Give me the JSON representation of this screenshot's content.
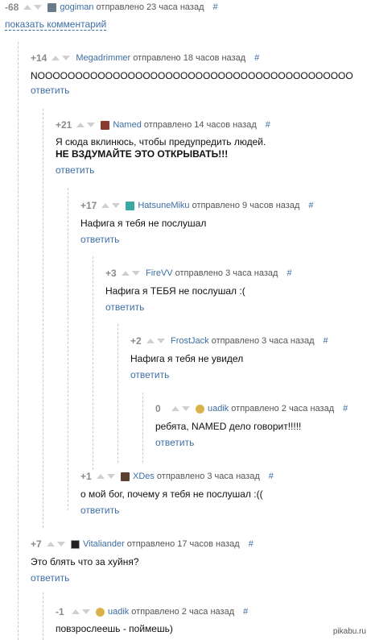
{
  "show_comments_label": "показать комментарий",
  "watermark": "pikabu.ru",
  "colors": {
    "link": "#3d6ea3",
    "rating": "#8a8a8a",
    "arrow": "#cfcfcf",
    "guide": "#c9c9c9"
  },
  "icons": {
    "upvote": "triangle-up",
    "downvote": "triangle-down"
  },
  "comments": [
    {
      "rating": "-68",
      "author": "gogiman",
      "sent": "отправлено 23 часа назад",
      "hash": "#",
      "body": "",
      "body_strong": "",
      "reply": "",
      "avatar_color": "#6b7b8a"
    },
    {
      "rating": "+14",
      "author": "Megadrimmer",
      "sent": "отправлено 18 часов назад",
      "hash": "#",
      "body": "NOOOOOOOOOOOOOOOOOOOOOOOOOOOOOOOOOOOOOOOOOO",
      "body_strong": "",
      "reply": "ответить",
      "avatar_color": ""
    },
    {
      "rating": "+21",
      "author": "Named",
      "sent": "отправлено 14 часов назад",
      "hash": "#",
      "body": "Я сюда вклинюсь, чтобы предупредить людей.",
      "body_strong": "НЕ ВЗДУМАЙТЕ ЭТО ОТКРЫВАТЬ!!!",
      "reply": "ответить",
      "avatar_color": "#8a3a2e"
    },
    {
      "rating": "+17",
      "author": "HatsuneMiku",
      "sent": "отправлено 9 часов назад",
      "hash": "#",
      "body": "Нафига я тебя не послушал",
      "body_strong": "",
      "reply": "ответить",
      "avatar_color": "#3aa7a0"
    },
    {
      "rating": "+3",
      "author": "FireVV",
      "sent": "отправлено 3 часа назад",
      "hash": "#",
      "body": "Нафига я ТЕБЯ не послушал :(",
      "body_strong": "",
      "reply": "ответить",
      "avatar_color": ""
    },
    {
      "rating": "+2",
      "author": "FrostJack",
      "sent": "отправлено 3 часа назад",
      "hash": "#",
      "body": "Нафига я тебя не увидел",
      "body_strong": "",
      "reply": "ответить",
      "avatar_color": ""
    },
    {
      "rating": "0",
      "author": "uadik",
      "sent": "отправлено 2 часа назад",
      "hash": "#",
      "body": "ребята, NAMED дело говорит!!!!!",
      "body_strong": "",
      "reply": "ответить",
      "avatar_color": "#d9b24a"
    },
    {
      "rating": "+1",
      "author": "XDes",
      "sent": "отправлено 3 часа назад",
      "hash": "#",
      "body": "о мой бог, почему я тебя не послушал :((",
      "body_strong": "",
      "reply": "ответить",
      "avatar_color": "#5a4030"
    },
    {
      "rating": "+7",
      "author": "Vitaliander",
      "sent": "отправлено 17 часов назад",
      "hash": "#",
      "body": "Это блять что за хуйня?",
      "body_strong": "",
      "reply": "ответить",
      "avatar_color": "#222222"
    },
    {
      "rating": "-1",
      "author": "uadik",
      "sent": "отправлено 2 часа назад",
      "hash": "#",
      "body": "повзрослеешь - поймешь)",
      "body_strong": "",
      "reply": "",
      "avatar_color": "#d9b24a"
    }
  ]
}
